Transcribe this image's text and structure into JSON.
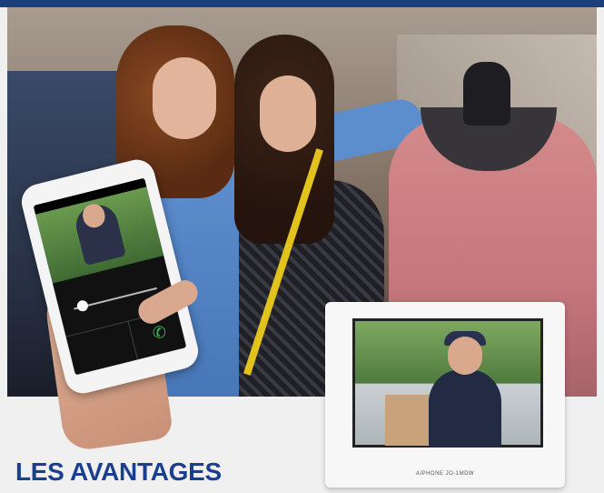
{
  "headline": "LES AVANTAGES",
  "monitor": {
    "brand_label": "AIPHONE JO-1MDW"
  },
  "phone": {
    "answer_icon": "phone-answer-icon"
  },
  "colors": {
    "accent": "#1a3f8f",
    "top_strip": "#1a3f7a",
    "answer_green": "#35c24a"
  }
}
